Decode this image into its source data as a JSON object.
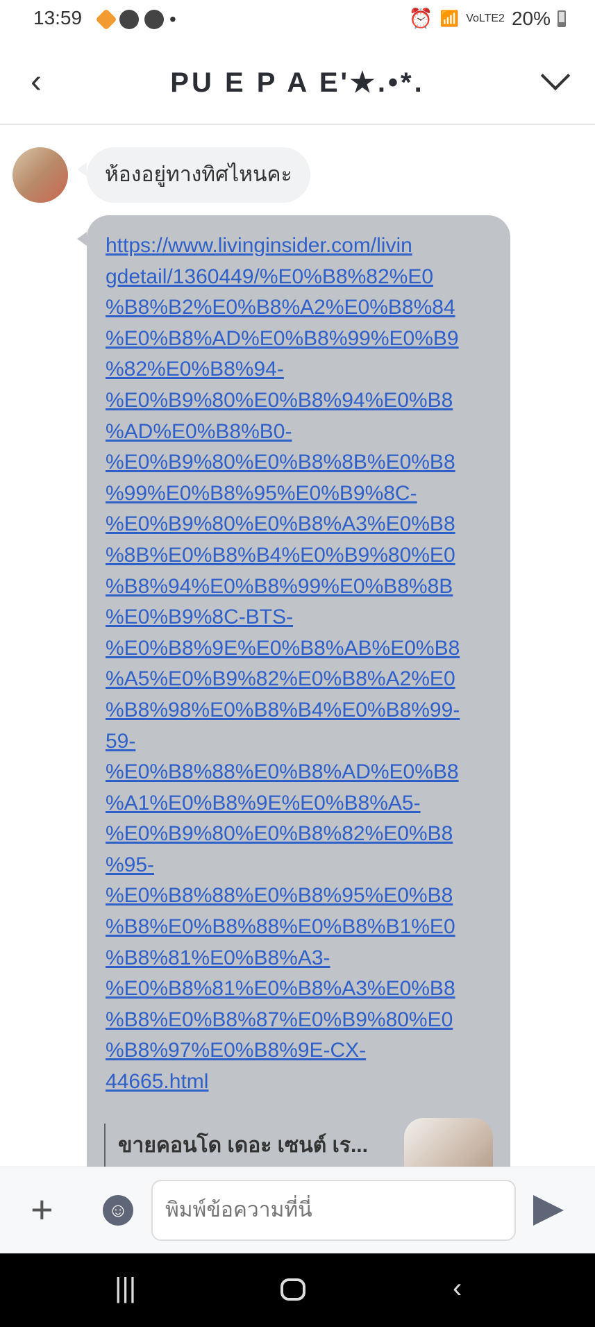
{
  "status": {
    "time": "13:59",
    "battery": "20%",
    "network": "VoLTE2"
  },
  "header": {
    "title": "PU E P A E'★.•*.",
    "back_icon": "chevron-left-icon",
    "menu_icon": "chevron-down-icon"
  },
  "messages": [
    {
      "text": "ห้องอยู่ทางทิศไหนคะ"
    },
    {
      "link_lines": [
        "https://www.livinginsider.com/livin",
        "gdetail/1360449/%E0%B8%82%E0",
        "%B8%B2%E0%B8%A2%E0%B8%84",
        "%E0%B8%AD%E0%B8%99%E0%B9",
        "%82%E0%B8%94-",
        "%E0%B9%80%E0%B8%94%E0%B8",
        "%AD%E0%B8%B0-",
        "%E0%B9%80%E0%B8%8B%E0%B8",
        "%99%E0%B8%95%E0%B9%8C-",
        "%E0%B9%80%E0%B8%A3%E0%B8",
        "%8B%E0%B8%B4%E0%B9%80%E0",
        "%B8%94%E0%B8%99%E0%B8%8B",
        "%E0%B9%8C-BTS-",
        "%E0%B8%9E%E0%B8%AB%E0%B8",
        "%A5%E0%B9%82%E0%B8%A2%E0",
        "%B8%98%E0%B8%B4%E0%B8%99-",
        "59-",
        "%E0%B8%88%E0%B8%AD%E0%B8",
        "%A1%E0%B8%9E%E0%B8%A5-",
        "%E0%B9%80%E0%B8%82%E0%B8",
        "%95-",
        "%E0%B8%88%E0%B8%95%E0%B8",
        "%B8%E0%B8%88%E0%B8%B1%E0",
        "%B8%81%E0%B8%A3-",
        "%E0%B8%81%E0%B8%A3%E0%B8",
        "%B8%E0%B8%87%E0%B9%80%E0",
        "%B8%97%E0%B8%9E-CX-",
        "44665.html"
      ],
      "preview_title": "ขายคอนโด เดอะ เซนต์ เร..."
    }
  ],
  "composer": {
    "placeholder": "พิมพ์ข้อความที่นี่"
  }
}
